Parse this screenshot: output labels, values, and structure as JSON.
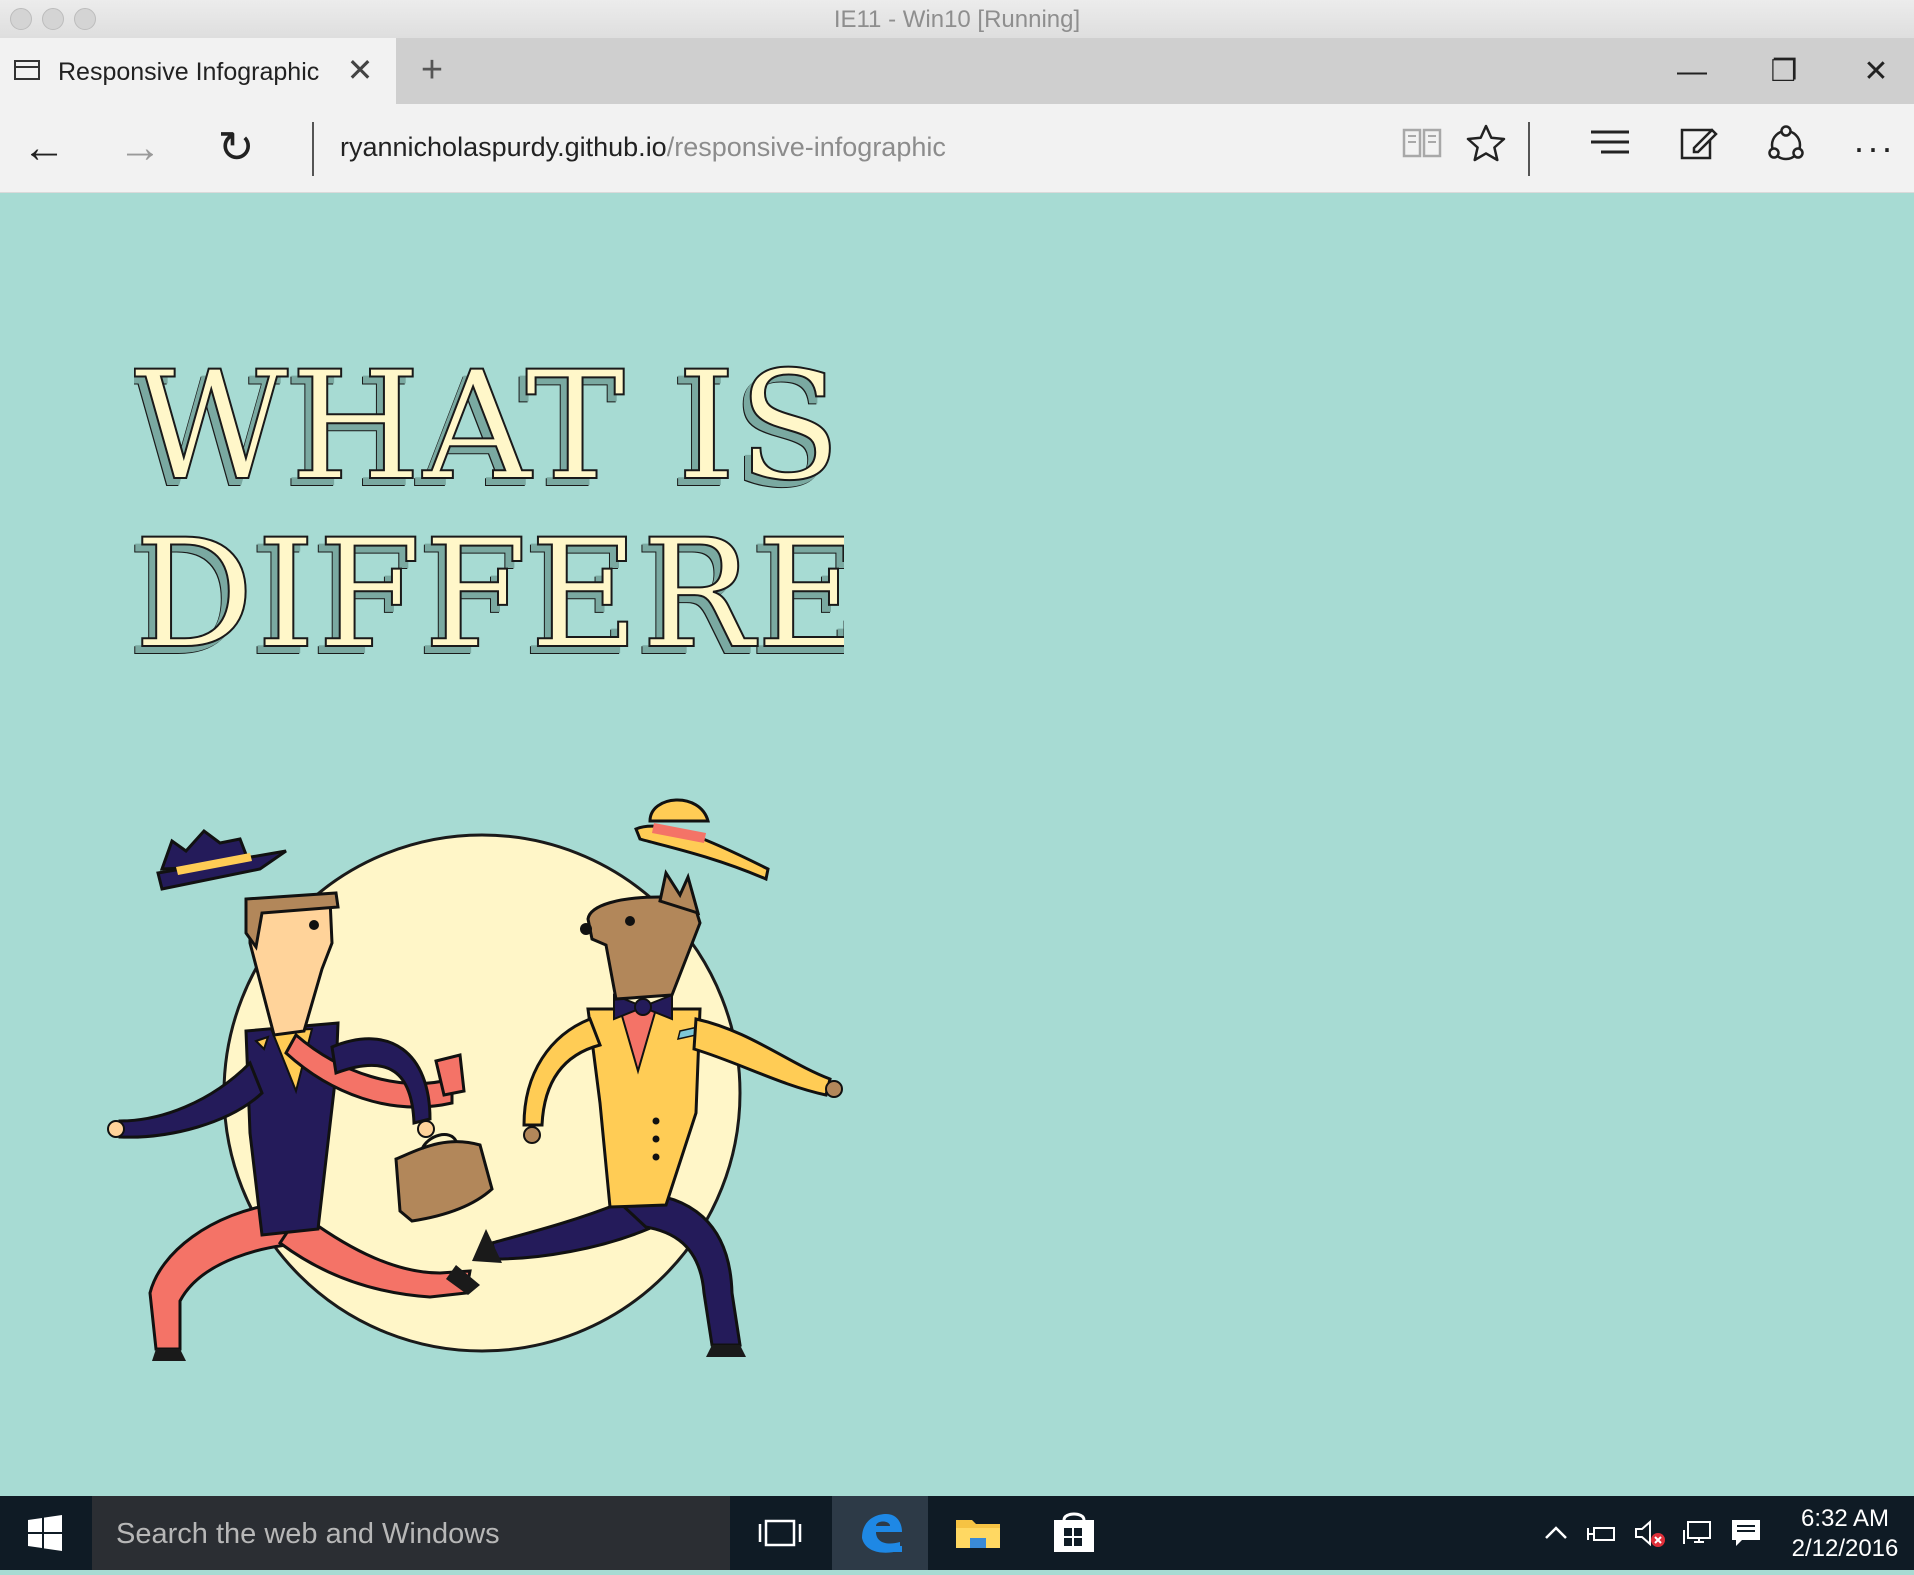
{
  "host_window": {
    "title": "IE11 - Win10 [Running]"
  },
  "browser": {
    "tab": {
      "title": "Responsive Infographic",
      "close_glyph": "✕"
    },
    "new_tab_glyph": "+",
    "window_controls": {
      "minimize": "—",
      "restore": "❐",
      "close": "✕"
    },
    "nav": {
      "back": "←",
      "forward": "→",
      "refresh": "↻"
    },
    "url": {
      "host": "ryannicholaspurdy.github.io",
      "path": "/responsive-infographic"
    },
    "toolbar_icons": [
      "reading-view-icon",
      "favorite-star-icon",
      "hub-icon",
      "web-note-icon",
      "share-icon",
      "more-icon"
    ],
    "more_glyph": "···"
  },
  "page": {
    "background": "#a7dbd3",
    "headline_line1": "WHAT IS",
    "headline_line2": "DIFFERENT",
    "colors": {
      "headline_fill": "#fff7c9",
      "navy": "#241b5a",
      "coral": "#f47367",
      "mustard": "#ffcc55",
      "cream": "#fff6c8",
      "brown": "#b2875a"
    }
  },
  "taskbar": {
    "search_placeholder": "Search the web and Windows",
    "apps": [
      "task-view-icon",
      "edge-icon",
      "file-explorer-icon",
      "store-icon"
    ],
    "clock_time": "6:32 AM",
    "clock_date": "2/12/2016"
  }
}
